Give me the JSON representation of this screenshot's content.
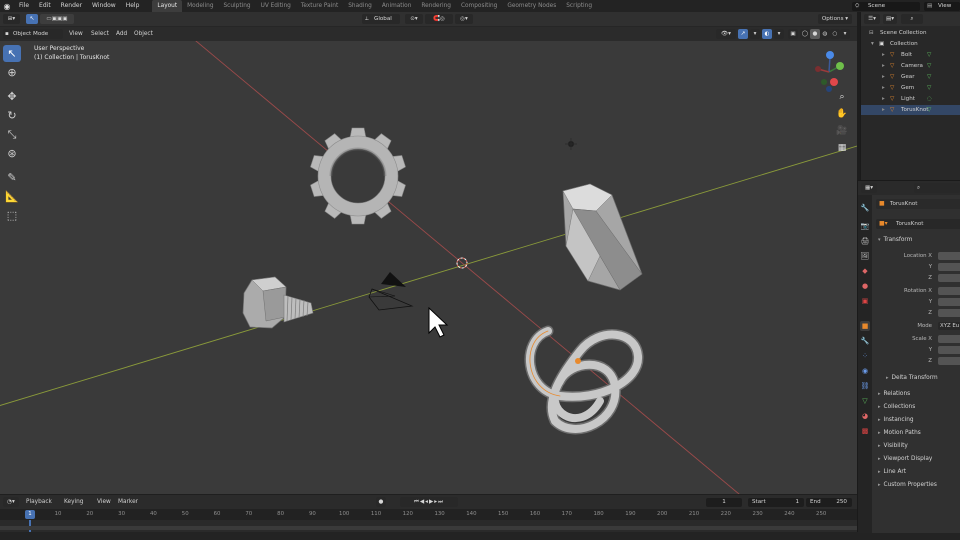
{
  "topbar": {
    "menus": [
      "File",
      "Edit",
      "Render",
      "Window",
      "Help"
    ],
    "workspaces": [
      "Layout",
      "Modeling",
      "Sculpting",
      "UV Editing",
      "Texture Paint",
      "Shading",
      "Animation",
      "Rendering",
      "Compositing",
      "Geometry Nodes",
      "Scripting"
    ],
    "active_workspace": "Layout",
    "scene": "Scene",
    "view_layer": "View"
  },
  "viewport_header": {
    "transform_orientation": "Global",
    "options_label": "Options",
    "mode": "Object Mode",
    "menus": [
      "View",
      "Select",
      "Add",
      "Object"
    ]
  },
  "viewport": {
    "view_name": "User Perspective",
    "context": "(1) Collection | TorusKnot",
    "gizmo_axes": [
      "X",
      "Y",
      "Z"
    ]
  },
  "outliner": {
    "title": "Scene Collection",
    "collection": "Collection",
    "objects": [
      "Bolt",
      "Camera",
      "Gear",
      "Gem",
      "Light",
      "TorusKnot"
    ]
  },
  "properties": {
    "object_name": "TorusKnot",
    "data_name": "TorusKnot",
    "transform_title": "Transform",
    "location_label": "Location X",
    "rotation_label": "Rotation X",
    "scale_label": "Scale X",
    "y_label": "Y",
    "z_label": "Z",
    "mode_label": "Mode",
    "mode_value": "XYZ Eu",
    "sections": [
      "Delta Transform",
      "Relations",
      "Collections",
      "Instancing",
      "Motion Paths",
      "Visibility",
      "Viewport Display",
      "Line Art",
      "Custom Properties"
    ]
  },
  "timeline": {
    "menus": [
      "Playback",
      "Keying",
      "View",
      "Marker"
    ],
    "current_frame": "1",
    "start_label": "Start",
    "start": "1",
    "end_label": "End",
    "end": "250",
    "ruler_ticks": [
      "1",
      "10",
      "20",
      "30",
      "40",
      "50",
      "60",
      "70",
      "80",
      "90",
      "100",
      "110",
      "120",
      "130",
      "140",
      "150",
      "160",
      "170",
      "180",
      "190",
      "200",
      "210",
      "220",
      "230",
      "240",
      "250"
    ]
  },
  "colors": {
    "accent": "#4772b3",
    "viewport_bg": "#3a3a3a",
    "x_axis": "#9b4a4a",
    "y_axis": "#8a9a3a",
    "object_orange": "#e8892c"
  }
}
